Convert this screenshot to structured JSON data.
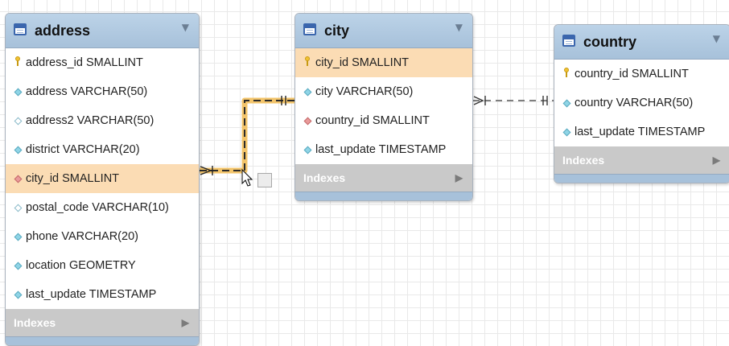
{
  "tables": {
    "address": {
      "name": "address",
      "fields": [
        {
          "label": "address_id SMALLINT",
          "kind": "pk",
          "icon": "primary-key-icon"
        },
        {
          "label": "address VARCHAR(50)",
          "kind": "col",
          "icon": "column-diamond-icon"
        },
        {
          "label": "address2 VARCHAR(50)",
          "kind": "nullable",
          "icon": "nullable-column-icon"
        },
        {
          "label": "district VARCHAR(20)",
          "kind": "col",
          "icon": "column-diamond-icon"
        },
        {
          "label": "city_id SMALLINT",
          "kind": "fk",
          "icon": "foreign-key-icon"
        },
        {
          "label": "postal_code VARCHAR(10)",
          "kind": "nullable",
          "icon": "nullable-column-icon"
        },
        {
          "label": "phone VARCHAR(20)",
          "kind": "col",
          "icon": "column-diamond-icon"
        },
        {
          "label": "location GEOMETRY",
          "kind": "col",
          "icon": "column-diamond-icon"
        },
        {
          "label": "last_update TIMESTAMP",
          "kind": "col",
          "icon": "column-diamond-icon"
        }
      ],
      "indexes_label": "Indexes"
    },
    "city": {
      "name": "city",
      "fields": [
        {
          "label": "city_id SMALLINT",
          "kind": "pk",
          "icon": "primary-key-icon"
        },
        {
          "label": "city VARCHAR(50)",
          "kind": "col",
          "icon": "column-diamond-icon"
        },
        {
          "label": "country_id SMALLINT",
          "kind": "fk",
          "icon": "foreign-key-icon"
        },
        {
          "label": "last_update TIMESTAMP",
          "kind": "col",
          "icon": "column-diamond-icon"
        }
      ],
      "indexes_label": "Indexes"
    },
    "country": {
      "name": "country",
      "fields": [
        {
          "label": "country_id SMALLINT",
          "kind": "pk",
          "icon": "primary-key-icon"
        },
        {
          "label": "country VARCHAR(50)",
          "kind": "col",
          "icon": "column-diamond-icon"
        },
        {
          "label": "last_update TIMESTAMP",
          "kind": "col",
          "icon": "column-diamond-icon"
        }
      ],
      "indexes_label": "Indexes"
    }
  },
  "relationships": [
    {
      "from": "address.city_id",
      "to": "city.city_id",
      "highlighted": true
    },
    {
      "from": "city.country_id",
      "to": "country.country_id",
      "highlighted": false
    }
  ],
  "colors": {
    "header": "#a7c1da",
    "selected_row": "#fbdcb4",
    "highlight_line": "#e59a1c",
    "normal_line": "#555555"
  }
}
